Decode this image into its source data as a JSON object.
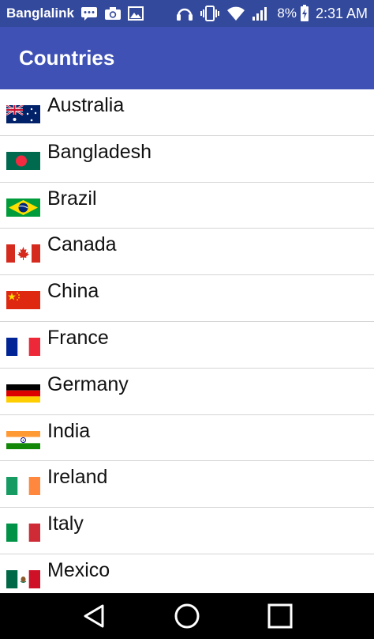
{
  "status_bar": {
    "carrier": "Banglalink",
    "battery": "8%",
    "time": "2:31 AM"
  },
  "app_bar": {
    "title": "Countries"
  },
  "countries": [
    {
      "name": "Australia"
    },
    {
      "name": "Bangladesh"
    },
    {
      "name": "Brazil"
    },
    {
      "name": "Canada"
    },
    {
      "name": "China"
    },
    {
      "name": "France"
    },
    {
      "name": "Germany"
    },
    {
      "name": "India"
    },
    {
      "name": "Ireland"
    },
    {
      "name": "Italy"
    },
    {
      "name": "Mexico"
    }
  ],
  "colors": {
    "status_bar": "#33499c",
    "app_bar": "#3f51b5",
    "divider": "#d5d5d5",
    "nav_bar": "#000000"
  }
}
